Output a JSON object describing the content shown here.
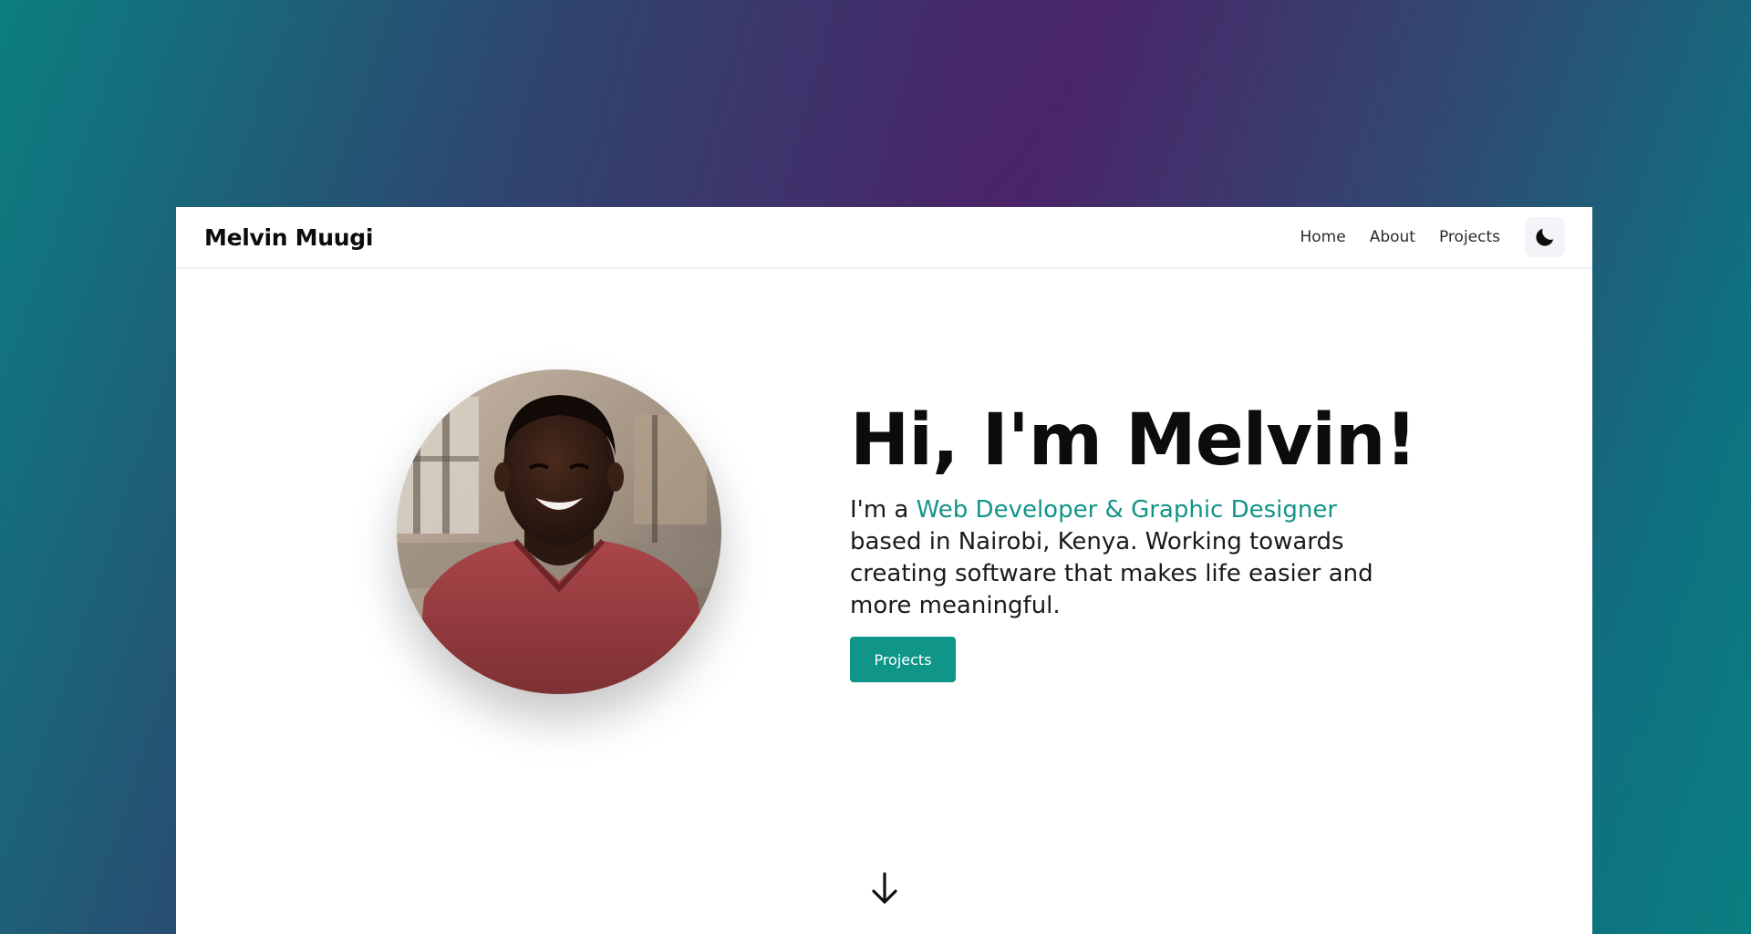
{
  "background": {
    "gradient_colors": [
      "#0b7f81",
      "#30426e",
      "#4b2368",
      "#35436f",
      "#0a7f81"
    ]
  },
  "navbar": {
    "brand": "Melvin Muugi",
    "links": [
      {
        "label": "Home"
      },
      {
        "label": "About"
      },
      {
        "label": "Projects"
      }
    ],
    "theme_toggle_icon": "moon-icon"
  },
  "hero": {
    "greeting": "Hi, I'm Melvin!",
    "intro_prefix": "I'm a ",
    "intro_highlight": "Web Developer & Graphic Designer",
    "intro_suffix": " based in Nairobi, Kenya. Working towards creating software that makes life easier and more meaningful.",
    "button_label": "Projects",
    "accent_color": "#129488",
    "avatar_alt": "Melvin Muugi",
    "scroll_icon": "arrow-down-icon"
  }
}
